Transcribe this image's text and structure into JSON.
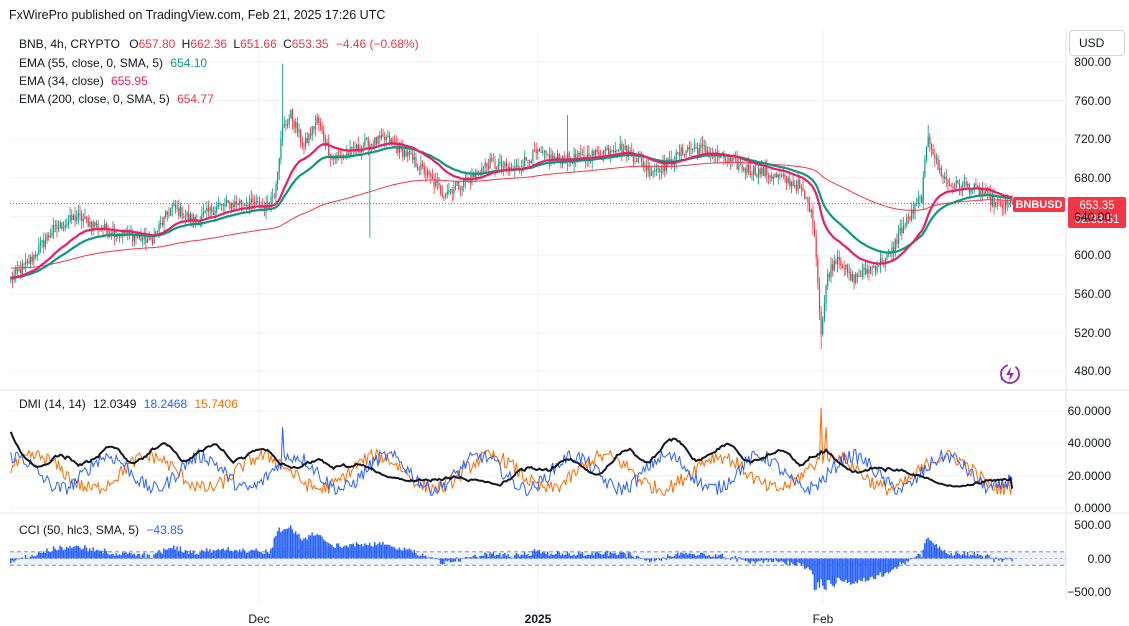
{
  "header": {
    "published": "FxWirePro published on TradingView.com, Feb 21, 2025 17:26 UTC"
  },
  "legend": {
    "symbol": "BNB, 4h, CRYPTO",
    "o_label": "O",
    "o_value": "657.80",
    "h_label": "H",
    "h_value": "662.36",
    "l_label": "L",
    "l_value": "651.66",
    "c_label": "C",
    "c_value": "653.35",
    "change": "−4.46 (−0.68%)",
    "ema55_label": "EMA (55, close, 0, SMA, 5)",
    "ema55_value": "654.10",
    "ema34_label": "EMA (34, close)",
    "ema34_value": "655.95",
    "ema200_label": "EMA (200, close, 0, SMA, 5)",
    "ema200_value": "654.77",
    "dmi_label": "DMI (14, 14)",
    "dmi_adx": "12.0349",
    "dmi_plus": "18.2468",
    "dmi_minus": "15.7406",
    "cci_label": "CCI (50, hlc3, SMA, 5)",
    "cci_value": "−43.85"
  },
  "currency_button": "USD",
  "price_tag": {
    "symbol": "BNBUSD",
    "price": "653.35",
    "countdown": "02:33:51"
  },
  "colors": {
    "up": "#089981",
    "down": "#f23645",
    "ema55": "#089981",
    "ema34": "#e91e63",
    "ema200": "#f23645",
    "adx": "#131722",
    "di_plus": "#2962ff",
    "di_minus": "#ff6d00",
    "cci": "#2962ff"
  },
  "price_axis": [
    "800.00",
    "760.00",
    "720.00",
    "680.00",
    "640.00",
    "600.00",
    "560.00",
    "520.00",
    "480.00"
  ],
  "dmi_axis": [
    "60.0000",
    "40.0000",
    "20.0000",
    "0.0000"
  ],
  "cci_axis": [
    "500.00",
    "0.00",
    "−500.00"
  ],
  "time_axis": [
    {
      "label": "Dec",
      "bold": false
    },
    {
      "label": "2025",
      "bold": true
    },
    {
      "label": "Feb",
      "bold": false
    }
  ],
  "chart_data": [
    {
      "type": "candlestick",
      "title": "BNB, 4h, CRYPTO",
      "ylim": [
        470,
        805
      ],
      "x_range": [
        "2024-11-04",
        "2025-02-21"
      ],
      "anchors_close": [
        [
          0,
          575
        ],
        [
          12,
          595
        ],
        [
          25,
          625
        ],
        [
          40,
          640
        ],
        [
          55,
          628
        ],
        [
          70,
          622
        ],
        [
          85,
          615
        ],
        [
          98,
          650
        ],
        [
          112,
          635
        ],
        [
          125,
          650
        ],
        [
          140,
          655
        ],
        [
          155,
          650
        ],
        [
          160,
          665
        ],
        [
          165,
          730
        ],
        [
          170,
          745
        ],
        [
          178,
          712
        ],
        [
          186,
          740
        ],
        [
          195,
          700
        ],
        [
          205,
          705
        ],
        [
          215,
          715
        ],
        [
          228,
          720
        ],
        [
          240,
          705
        ],
        [
          252,
          685
        ],
        [
          262,
          665
        ],
        [
          272,
          672
        ],
        [
          280,
          680
        ],
        [
          290,
          695
        ],
        [
          305,
          688
        ],
        [
          318,
          705
        ],
        [
          330,
          700
        ],
        [
          345,
          700
        ],
        [
          358,
          706
        ],
        [
          368,
          713
        ],
        [
          378,
          703
        ],
        [
          388,
          688
        ],
        [
          398,
          693
        ],
        [
          410,
          710
        ],
        [
          420,
          710
        ],
        [
          432,
          700
        ],
        [
          445,
          690
        ],
        [
          458,
          685
        ],
        [
          470,
          678
        ],
        [
          478,
          672
        ],
        [
          485,
          650
        ],
        [
          488,
          625
        ],
        [
          492,
          520
        ],
        [
          496,
          580
        ],
        [
          502,
          600
        ],
        [
          510,
          575
        ],
        [
          518,
          582
        ],
        [
          526,
          590
        ],
        [
          534,
          600
        ],
        [
          540,
          625
        ],
        [
          546,
          640
        ],
        [
          553,
          660
        ],
        [
          557,
          725
        ],
        [
          563,
          690
        ],
        [
          570,
          672
        ],
        [
          580,
          672
        ],
        [
          590,
          665
        ],
        [
          600,
          650
        ],
        [
          608,
          653
        ]
      ]
    },
    {
      "type": "line",
      "title": "DMI (14, 14)",
      "ylim": [
        0,
        65
      ],
      "series": [
        {
          "name": "ADX",
          "last": 12.0349
        },
        {
          "name": "+DI",
          "last": 18.2468
        },
        {
          "name": "−DI",
          "last": 15.7406
        }
      ]
    },
    {
      "type": "histogram",
      "title": "CCI (50, hlc3, SMA, 5)",
      "ylim": [
        -650,
        650
      ],
      "last": -43.85,
      "bands": [
        100,
        -100
      ]
    }
  ]
}
